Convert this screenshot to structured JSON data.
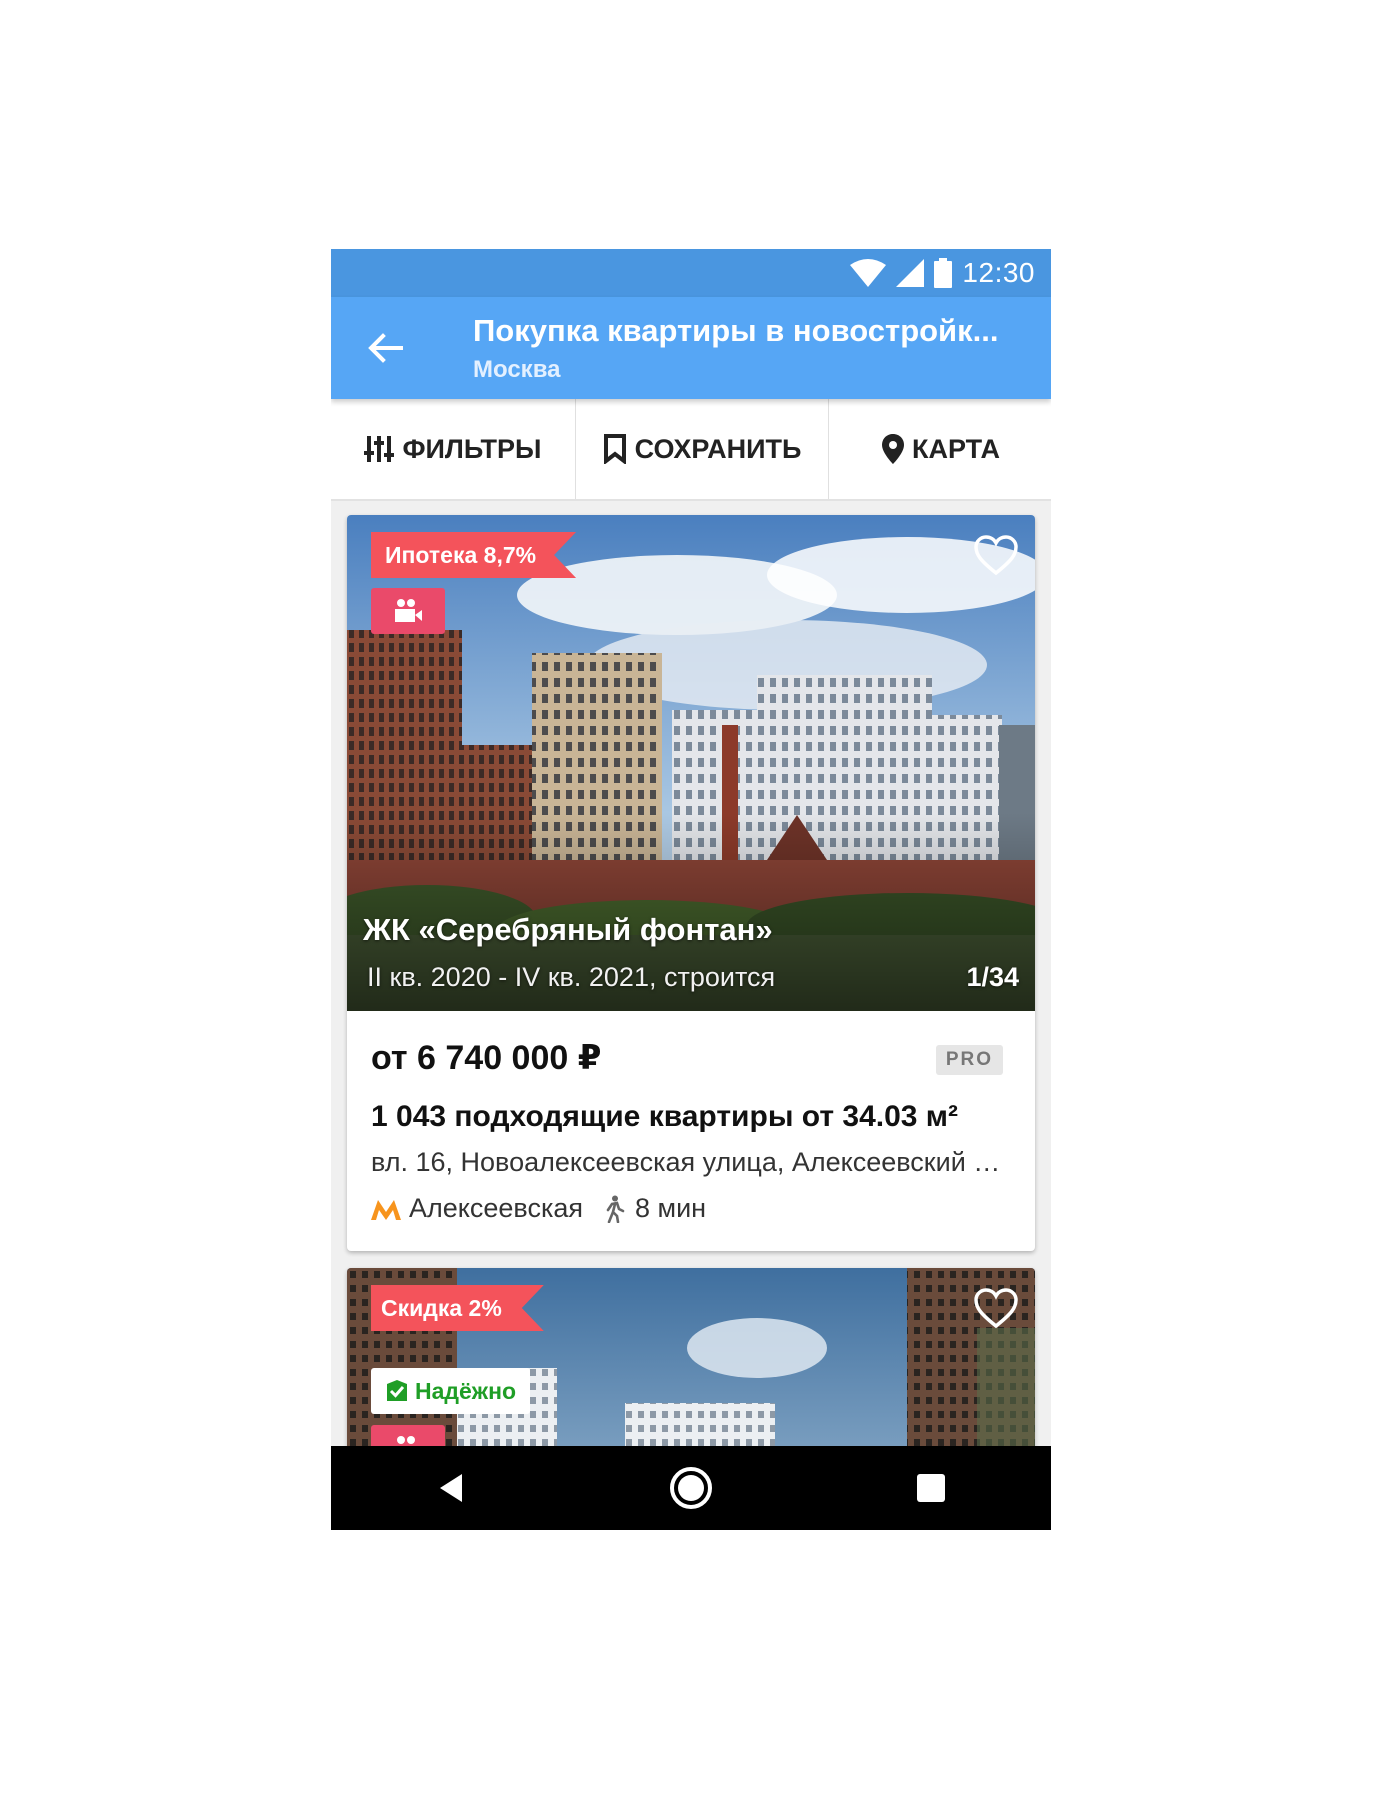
{
  "status_bar": {
    "time": "12:30"
  },
  "app_bar": {
    "title": "Покупка квартиры в новостройк...",
    "subtitle": "Москва"
  },
  "actions": {
    "filters": "ФИЛЬТРЫ",
    "save": "СОХРАНИТЬ",
    "map": "КАРТА"
  },
  "listings": [
    {
      "promo": "Ипотека 8,7%",
      "name": "ЖК «Серебряный фонтан»",
      "dates": "II кв. 2020 - IV кв. 2021, строится",
      "photo_counter": "1/34",
      "price": "от 6 740 000 ₽",
      "badge": "PRO",
      "flats": "1 043 подходящие квартиры от 34.03 м²",
      "address": "вл. 16, Новоалексеевская улица, Алексеевский район",
      "metro_station": "Алексеевская",
      "walk_time": "8 мин"
    },
    {
      "promo": "Скидка 2%",
      "reliability": "Надёжно"
    }
  ],
  "colors": {
    "status_bar": "#4a96e0",
    "app_bar": "#56a6f5",
    "promo_ribbon": "#f4535b",
    "video_badge": "#ea4a6a",
    "metro": "#f7941d",
    "reliable": "#1f9e26"
  }
}
